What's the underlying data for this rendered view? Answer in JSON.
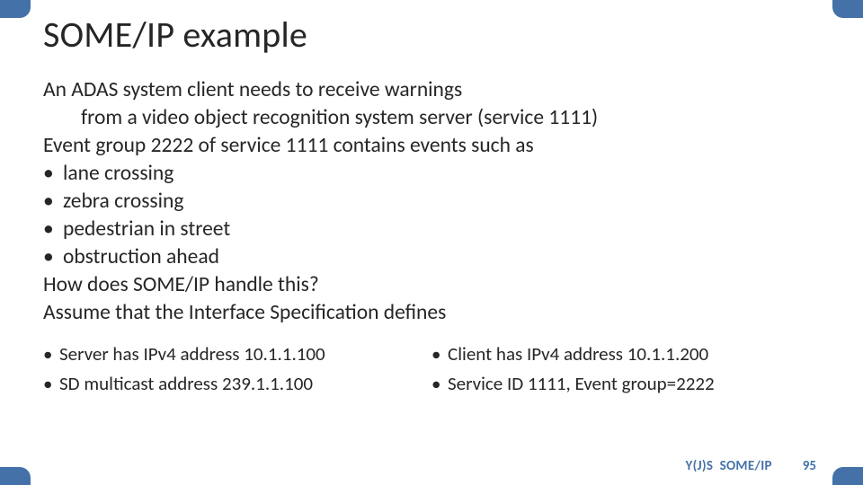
{
  "title": "SOME/IP example",
  "body": {
    "line1": "An ADAS system client needs to receive warnings",
    "line2": "from a video object recognition system server (service 1111)",
    "line3": "Event group 2222 of service 1111 contains events such as",
    "bullets": [
      "lane crossing",
      "zebra crossing",
      "pedestrian in street",
      "obstruction ahead"
    ],
    "line4": "How does SOME/IP handle this?",
    "line5": "Assume that the Interface Specification defines"
  },
  "columns": {
    "left": [
      "Server has IPv4 address 10.1.1.100",
      "SD multicast address 239.1.1.100"
    ],
    "right": [
      "Client has IPv4 address 10.1.1.200",
      "Service ID 1111, Event group=2222"
    ]
  },
  "footer": {
    "label": "Y(J)S  SOME/IP",
    "page": "95"
  },
  "colors": {
    "accent": "#4472a8"
  }
}
